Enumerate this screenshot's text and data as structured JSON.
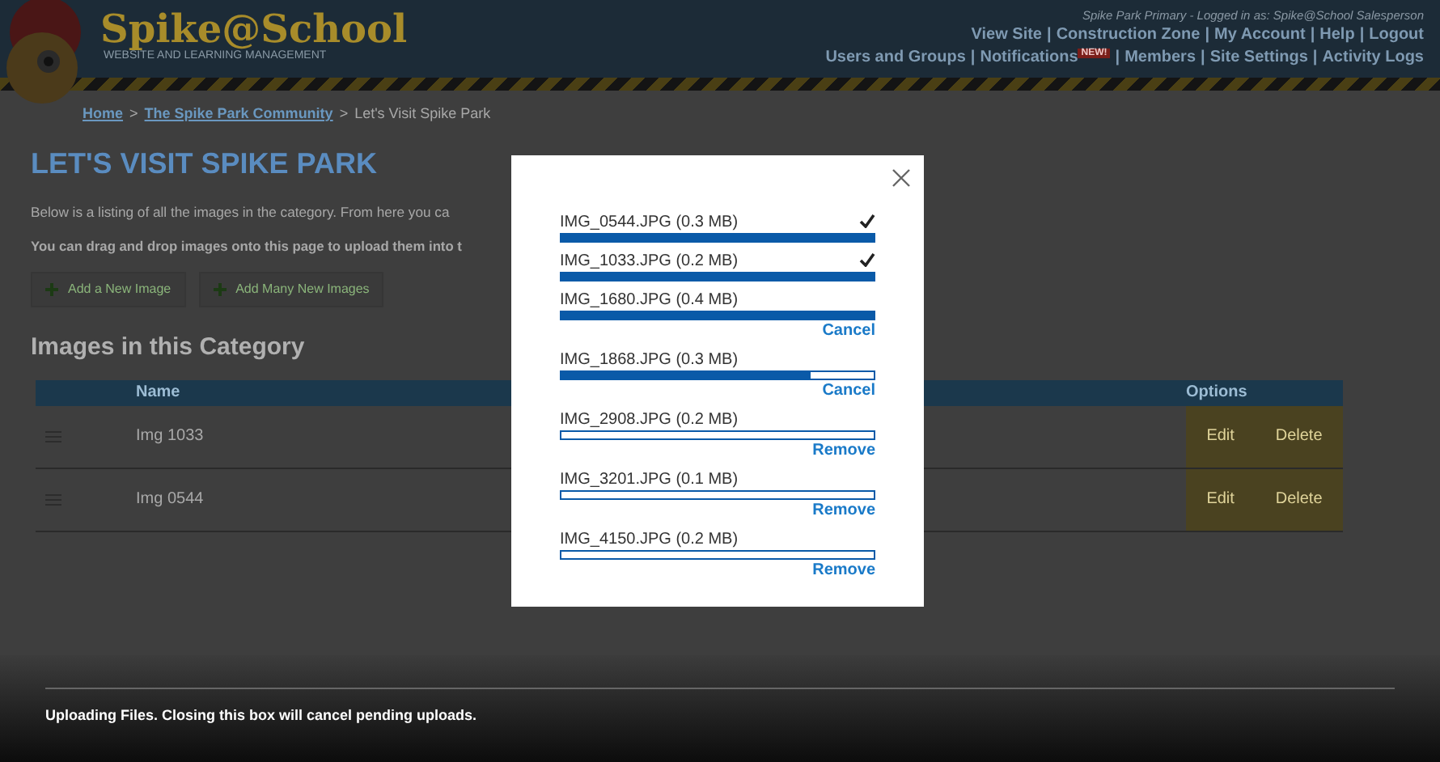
{
  "header": {
    "logo_title": "Spike@School",
    "logo_subtitle": "WEBSITE AND LEARNING MANAGEMENT",
    "login_info": "Spike Park Primary - Logged in as: Spike@School Salesperson",
    "separator": "|",
    "nav_rows": [
      [
        {
          "label": "View Site"
        },
        {
          "label": "Construction Zone"
        },
        {
          "label": "My Account"
        },
        {
          "label": "Help"
        },
        {
          "label": "Logout"
        }
      ],
      [
        {
          "label": "Users and Groups"
        },
        {
          "label": "Notifications",
          "badge": "NEW!"
        },
        {
          "label": "Members"
        },
        {
          "label": "Site Settings"
        },
        {
          "label": "Activity Logs"
        }
      ]
    ]
  },
  "breadcrumb_separator": ">",
  "breadcrumb": [
    {
      "label": "Home",
      "link": true
    },
    {
      "label": "The Spike Park Community",
      "link": true
    },
    {
      "label": "Let's Visit Spike Park",
      "link": false
    }
  ],
  "page_title": "LET'S VISIT SPIKE PARK",
  "intro": "Below is a listing of all the images in the category. From here you ca",
  "drag_note": "You can drag and drop images onto this page to upload them into t",
  "buttons": [
    "Add a New Image",
    "Add Many New Images"
  ],
  "section_title": "Images in this Category",
  "table": {
    "columns": [
      "Name",
      "Options"
    ],
    "rows": [
      {
        "name": "Img 1033",
        "actions": [
          "Edit",
          "Delete"
        ]
      },
      {
        "name": "Img 0544",
        "actions": [
          "Edit",
          "Delete"
        ]
      }
    ]
  },
  "upload_dialog": {
    "files": [
      {
        "name": "IMG_0544.JPG (0.3 MB)",
        "level": 1,
        "done": true
      },
      {
        "name": "IMG_1033.JPG (0.2 MB)",
        "level": 1,
        "done": true
      },
      {
        "name": "IMG_1680.JPG (0.4 MB)",
        "level": 1,
        "done": false,
        "action": "Cancel"
      },
      {
        "name": "IMG_1868.JPG (0.3 MB)",
        "level": 0.8,
        "done": false,
        "action": "Cancel"
      },
      {
        "name": "IMG_2908.JPG (0.2 MB)",
        "level": 0,
        "done": false,
        "action": "Remove"
      },
      {
        "name": "IMG_3201.JPG (0.1 MB)",
        "level": 0,
        "done": false,
        "action": "Remove"
      },
      {
        "name": "IMG_4150.JPG (0.2 MB)",
        "level": 0,
        "done": false,
        "action": "Remove"
      }
    ]
  },
  "status_bar": "Uploading Files. Closing this box will cancel pending uploads."
}
